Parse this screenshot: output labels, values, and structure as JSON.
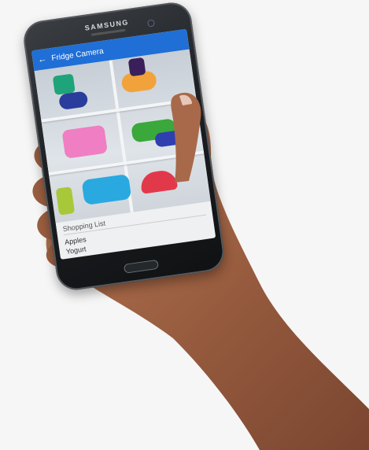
{
  "device": {
    "brand": "SAMSUNG"
  },
  "app": {
    "title": "Fridge Camera",
    "back_icon": "arrow-left-icon",
    "accent": "#1f6fd6"
  },
  "shopping_list": {
    "title": "Shopping List",
    "items": [
      "Apples",
      "Yogurt"
    ]
  }
}
